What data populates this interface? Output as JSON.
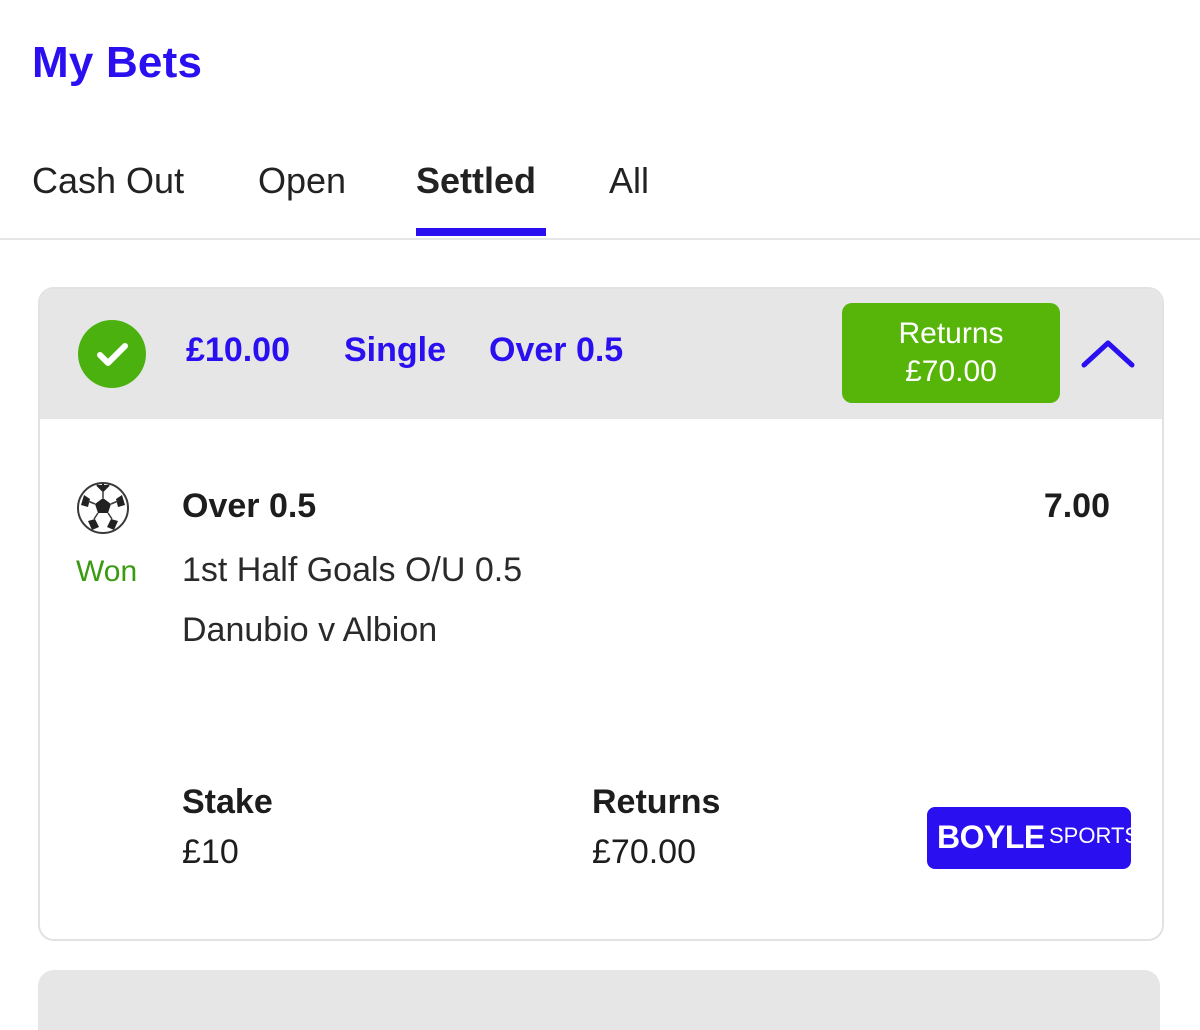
{
  "page": {
    "title": "My Bets"
  },
  "tabs": [
    {
      "label": "Cash Out"
    },
    {
      "label": "Open"
    },
    {
      "label": "Settled",
      "active": true
    },
    {
      "label": "All"
    }
  ],
  "bet": {
    "stake_display": "£10.00",
    "bet_type": "Single",
    "selection_summary": "Over 0.5",
    "returns_label": "Returns",
    "returns_value": "£70.00",
    "status": "Won",
    "selection": "Over 0.5",
    "odds": "7.00",
    "market": "1st Half Goals O/U 0.5",
    "event": "Danubio v Albion",
    "stake_label": "Stake",
    "stake_value": "£10",
    "footer_returns_label": "Returns",
    "footer_returns_value": "£70.00",
    "brand": {
      "main": "BOYLE",
      "sub": "SPORTS"
    }
  },
  "colors": {
    "accent": "#2a0ff0",
    "won_green": "#56b508",
    "won_text": "#3a9a10",
    "header_bg": "#e6e6e6"
  },
  "icons": {
    "status": "check-circle-icon",
    "sport": "soccer-ball-icon",
    "collapse": "chevron-up-icon"
  }
}
